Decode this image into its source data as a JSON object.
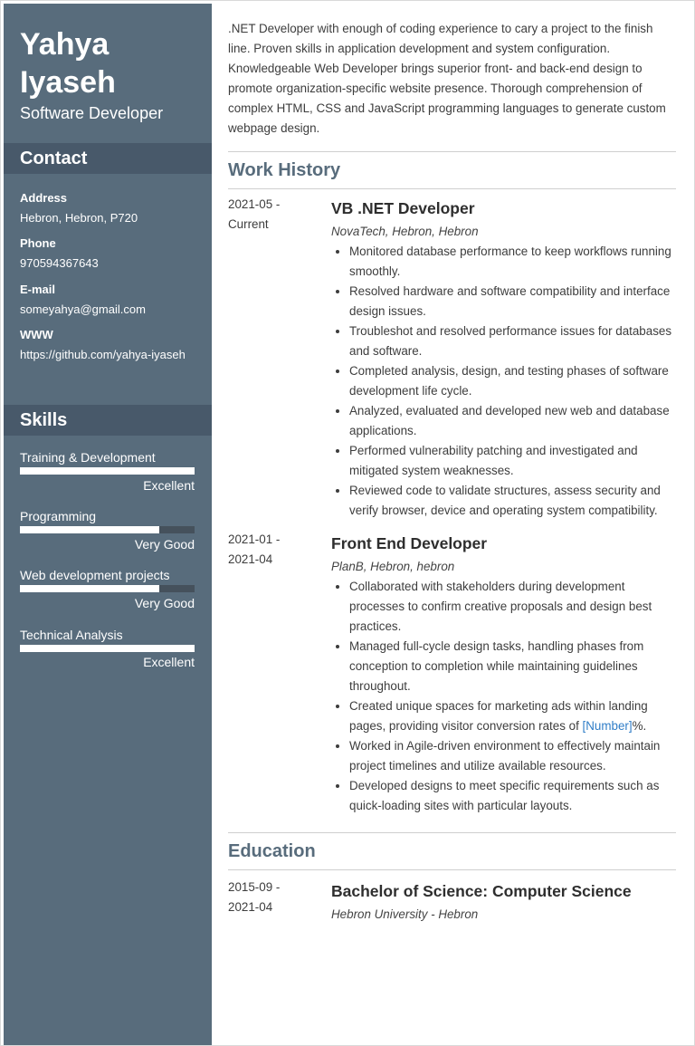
{
  "header": {
    "first_name": "Yahya",
    "last_name": "Iyaseh",
    "role": "Software Developer"
  },
  "contact": {
    "title": "Contact",
    "address_label": "Address",
    "address": "Hebron, Hebron, P720",
    "phone_label": "Phone",
    "phone": "970594367643",
    "email_label": "E-mail",
    "email": "someyahya@gmail.com",
    "www_label": "WWW",
    "www": "https://github.com/yahya-iyaseh"
  },
  "skills": {
    "title": "Skills",
    "items": [
      {
        "name": "Training & Development",
        "level": "Excellent",
        "fill": 1.0
      },
      {
        "name": "Programming",
        "level": "Very Good",
        "fill": 0.8
      },
      {
        "name": "Web development projects",
        "level": "Very Good",
        "fill": 0.8
      },
      {
        "name": "Technical Analysis",
        "level": "Excellent",
        "fill": 1.0
      }
    ]
  },
  "summary": {
    "p1": ".NET Developer with enough of coding experience to cary a project to the finish line. Proven skills in application development and system configuration.",
    "p2": "Knowledgeable Web Developer brings superior front- and back-end design to promote organization-specific website presence. Thorough comprehension of complex HTML, CSS and JavaScript programming languages to generate custom webpage design."
  },
  "work": {
    "title": "Work History",
    "jobs": [
      {
        "date_start": "2021-05 -",
        "date_end": "Current",
        "title": "VB .NET Developer",
        "company": "NovaTech, Hebron, Hebron",
        "duties": [
          "Monitored database performance to keep workflows running smoothly.",
          "Resolved hardware and software compatibility and interface design issues.",
          "Troubleshot and resolved performance issues for databases and software.",
          "Completed analysis, design, and testing phases of software development life cycle.",
          "Analyzed, evaluated and developed new web and database applications.",
          "Performed vulnerability patching and investigated and mitigated system weaknesses.",
          "Reviewed code to validate structures, assess security and verify browser, device and operating system compatibility."
        ]
      },
      {
        "date_start": "2021-01 -",
        "date_end": "2021-04",
        "title": "Front End Developer",
        "company": "PlanB, Hebron, hebron",
        "duties": [
          "Collaborated with stakeholders during development processes to confirm creative proposals and design best practices.",
          "Managed full-cycle design tasks, handling phases from conception to completion while maintaining guidelines throughout.",
          "Created unique spaces for marketing ads within landing pages, providing visitor conversion rates of ",
          "Worked in Agile-driven environment to effectively maintain project timelines and utilize available resources.",
          "Developed designs to meet specific requirements such as quick-loading sites with particular layouts."
        ],
        "placeholder": "[Number]",
        "placeholder_suffix": "%."
      }
    ]
  },
  "education": {
    "title": "Education",
    "date_start": "2015-09 -",
    "date_end": "2021-04",
    "degree": "Bachelor of Science: Computer Science",
    "school": "Hebron University - Hebron"
  }
}
